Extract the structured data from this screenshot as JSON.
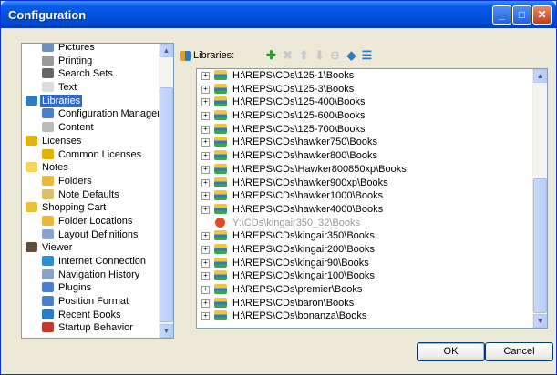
{
  "window": {
    "title": "Configuration"
  },
  "tree": {
    "items": [
      {
        "label": "Pictures",
        "indent": 2,
        "icon": "pictures-icon",
        "color": "#6f8fbf"
      },
      {
        "label": "Printing",
        "indent": 2,
        "icon": "printer-icon",
        "color": "#9a9a9a"
      },
      {
        "label": "Search Sets",
        "indent": 2,
        "icon": "binoculars-icon",
        "color": "#666"
      },
      {
        "label": "Text",
        "indent": 2,
        "icon": "document-icon",
        "color": "#ddd"
      },
      {
        "label": "Libraries",
        "indent": 1,
        "icon": "libraries-icon",
        "color": "#2b7bc5",
        "selected": true
      },
      {
        "label": "Configuration Manager",
        "indent": 2,
        "icon": "config-manager-icon",
        "color": "#4a7fd0"
      },
      {
        "label": "Content",
        "indent": 2,
        "icon": "content-icon",
        "color": "#bbb"
      },
      {
        "label": "Licenses",
        "indent": 1,
        "icon": "key-icon",
        "color": "#e0b400"
      },
      {
        "label": "Common Licenses",
        "indent": 2,
        "icon": "key-icon",
        "color": "#e0b400"
      },
      {
        "label": "Notes",
        "indent": 1,
        "icon": "notes-icon",
        "color": "#f5d65a"
      },
      {
        "label": "Folders",
        "indent": 2,
        "icon": "folder-icon",
        "color": "#e8b93c"
      },
      {
        "label": "Note Defaults",
        "indent": 2,
        "icon": "pencil-icon",
        "color": "#d9c06b"
      },
      {
        "label": "Shopping Cart",
        "indent": 1,
        "icon": "cart-icon",
        "color": "#e8c03c"
      },
      {
        "label": "Folder Locations",
        "indent": 2,
        "icon": "folder-icon",
        "color": "#e8b93c"
      },
      {
        "label": "Layout Definitions",
        "indent": 2,
        "icon": "layout-icon",
        "color": "#8aa2c8"
      },
      {
        "label": "Viewer",
        "indent": 1,
        "icon": "viewer-icon",
        "color": "#5d4f3a"
      },
      {
        "label": "Internet Connection",
        "indent": 2,
        "icon": "globe-icon",
        "color": "#2e8ecf"
      },
      {
        "label": "Navigation History",
        "indent": 2,
        "icon": "history-icon",
        "color": "#8aa2c8"
      },
      {
        "label": "Plugins",
        "indent": 2,
        "icon": "plugin-icon",
        "color": "#4a7fd0"
      },
      {
        "label": "Position Format",
        "indent": 2,
        "icon": "info-icon",
        "color": "#4a7fd0"
      },
      {
        "label": "Recent Books",
        "indent": 2,
        "icon": "recent-books-icon",
        "color": "#2b7bc5"
      },
      {
        "label": "Startup Behavior",
        "indent": 2,
        "icon": "startup-icon",
        "color": "#c0392b"
      }
    ]
  },
  "libraries": {
    "header_label": "Libraries:",
    "toolbar": [
      {
        "name": "add-library-icon",
        "glyph": "✚",
        "color": "#2ca02c"
      },
      {
        "name": "remove-library-icon",
        "glyph": "✖",
        "color": "#c8c8c8"
      },
      {
        "name": "move-up-icon",
        "glyph": "⬆",
        "color": "#c8c8c8"
      },
      {
        "name": "move-down-icon",
        "glyph": "⬇",
        "color": "#c8c8c8"
      },
      {
        "name": "disable-library-icon",
        "glyph": "⊖",
        "color": "#c8c8c8"
      },
      {
        "name": "library-properties-icon",
        "glyph": "◆",
        "color": "#2b7bc5"
      },
      {
        "name": "list-view-icon",
        "glyph": "☰",
        "color": "#2b7bc5"
      }
    ],
    "rows": [
      {
        "path": "H:\\REPS\\CDs\\125-1\\Books",
        "enabled": true
      },
      {
        "path": "H:\\REPS\\CDs\\125-3\\Books",
        "enabled": true
      },
      {
        "path": "H:\\REPS\\CDs\\125-400\\Books",
        "enabled": true
      },
      {
        "path": "H:\\REPS\\CDs\\125-600\\Books",
        "enabled": true
      },
      {
        "path": "H:\\REPS\\CDs\\125-700\\Books",
        "enabled": true
      },
      {
        "path": "H:\\REPS\\CDs\\hawker750\\Books",
        "enabled": true
      },
      {
        "path": "H:\\REPS\\CDs\\hawker800\\Books",
        "enabled": true
      },
      {
        "path": "H:\\REPS\\CDs\\Hawker800850xp\\Books",
        "enabled": true
      },
      {
        "path": "H:\\REPS\\CDs\\hawker900xp\\Books",
        "enabled": true
      },
      {
        "path": "H:\\REPS\\CDs\\hawker1000\\Books",
        "enabled": true
      },
      {
        "path": "H:\\REPS\\CDs\\hawker4000\\Books",
        "enabled": true
      },
      {
        "path": "Y:\\CDs\\kingair350_32\\Books",
        "enabled": false
      },
      {
        "path": "H:\\REPS\\CDs\\kingair350\\Books",
        "enabled": true
      },
      {
        "path": "H:\\REPS\\CDs\\kingair200\\Books",
        "enabled": true
      },
      {
        "path": "H:\\REPS\\CDs\\kingair90\\Books",
        "enabled": true
      },
      {
        "path": "H:\\REPS\\CDs\\kingair100\\Books",
        "enabled": true
      },
      {
        "path": "H:\\REPS\\CDs\\premier\\Books",
        "enabled": true
      },
      {
        "path": "H:\\REPS\\CDs\\baron\\Books",
        "enabled": true
      },
      {
        "path": "H:\\REPS\\CDs\\bonanza\\Books",
        "enabled": true
      }
    ]
  },
  "buttons": {
    "ok": "OK",
    "cancel": "Cancel"
  }
}
